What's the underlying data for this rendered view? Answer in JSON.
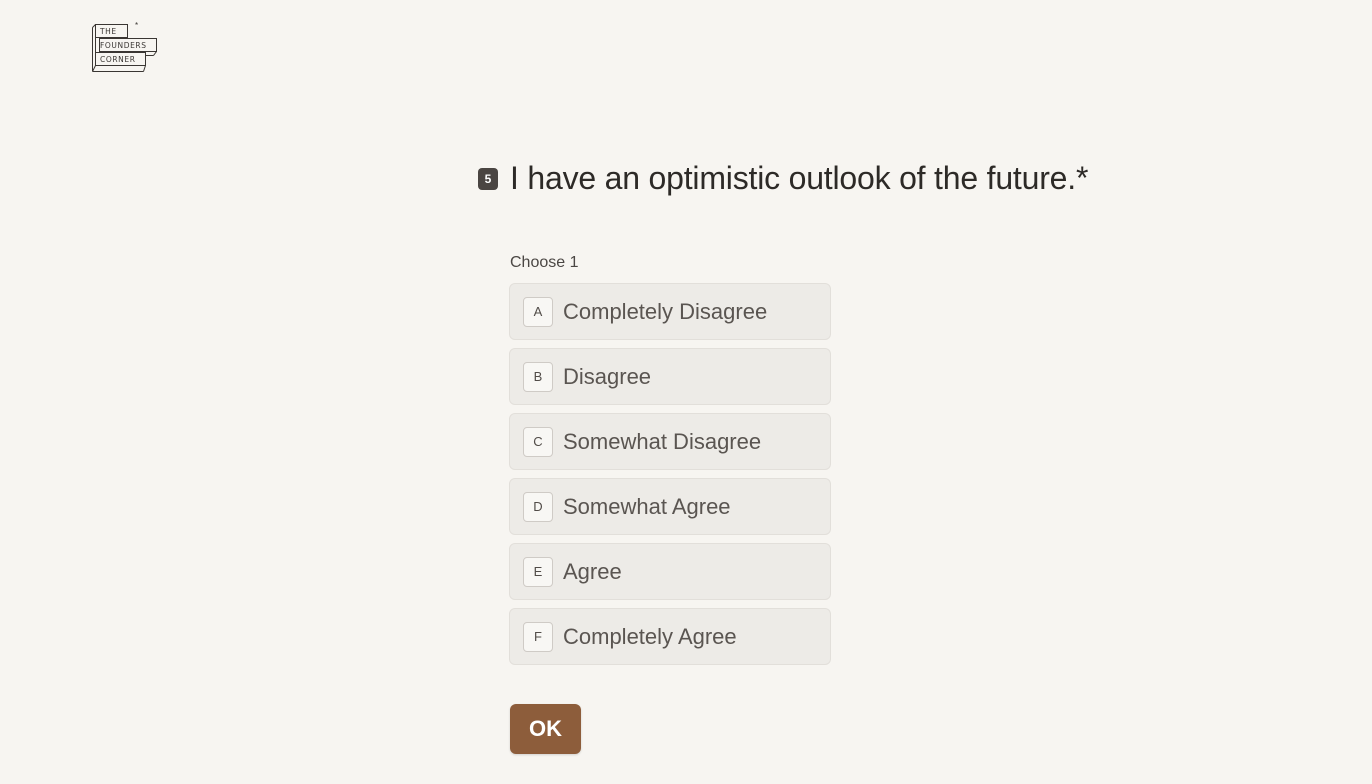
{
  "logo": {
    "line1": "THE",
    "line2": "FOUNDERS",
    "line3": "CORNER",
    "mark": "*"
  },
  "question": {
    "number": "5",
    "text": "I have an optimistic outlook of the future.*"
  },
  "hint": "Choose 1",
  "options": [
    {
      "key": "A",
      "label": "Completely Disagree"
    },
    {
      "key": "B",
      "label": "Disagree"
    },
    {
      "key": "C",
      "label": "Somewhat Disagree"
    },
    {
      "key": "D",
      "label": "Somewhat Agree"
    },
    {
      "key": "E",
      "label": "Agree"
    },
    {
      "key": "F",
      "label": "Completely Agree"
    }
  ],
  "ok_button": {
    "label": "OK"
  },
  "colors": {
    "background": "#f7f5f1",
    "accent": "#8d5d3b",
    "option_background": "#edebe7"
  }
}
